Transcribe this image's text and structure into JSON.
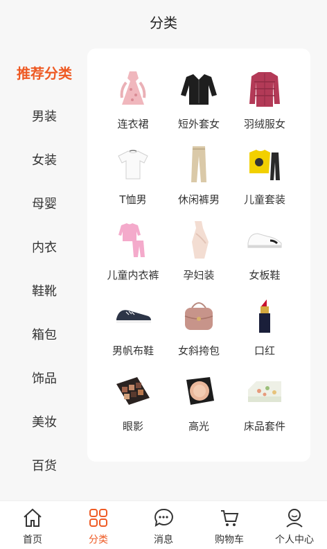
{
  "header": {
    "title": "分类"
  },
  "sidebar": {
    "items": [
      {
        "label": "推荐分类",
        "active": true
      },
      {
        "label": "男装"
      },
      {
        "label": "女装"
      },
      {
        "label": "母婴"
      },
      {
        "label": "内衣"
      },
      {
        "label": "鞋靴"
      },
      {
        "label": "箱包"
      },
      {
        "label": "饰品"
      },
      {
        "label": "美妆"
      },
      {
        "label": "百货"
      }
    ]
  },
  "grid": {
    "items": [
      {
        "label": "连衣裙",
        "icon": "dress-icon"
      },
      {
        "label": "短外套女",
        "icon": "cardigan-icon"
      },
      {
        "label": "羽绒服女",
        "icon": "down-jacket-icon"
      },
      {
        "label": "T恤男",
        "icon": "tshirt-icon"
      },
      {
        "label": "休闲裤男",
        "icon": "trousers-icon"
      },
      {
        "label": "儿童套装",
        "icon": "kids-set-icon"
      },
      {
        "label": "儿童内衣裤",
        "icon": "kids-underwear-icon"
      },
      {
        "label": "孕妇装",
        "icon": "maternity-dress-icon"
      },
      {
        "label": "女板鞋",
        "icon": "sneaker-icon"
      },
      {
        "label": "男帆布鞋",
        "icon": "canvas-shoe-icon"
      },
      {
        "label": "女斜挎包",
        "icon": "crossbody-bag-icon"
      },
      {
        "label": "口红",
        "icon": "lipstick-icon"
      },
      {
        "label": "眼影",
        "icon": "eyeshadow-icon"
      },
      {
        "label": "高光",
        "icon": "highlighter-icon"
      },
      {
        "label": "床品套件",
        "icon": "bedding-icon"
      }
    ]
  },
  "tabbar": {
    "items": [
      {
        "label": "首页",
        "icon": "home-icon"
      },
      {
        "label": "分类",
        "icon": "category-icon",
        "active": true
      },
      {
        "label": "消息",
        "icon": "message-icon"
      },
      {
        "label": "购物车",
        "icon": "cart-icon"
      },
      {
        "label": "个人中心",
        "icon": "profile-icon"
      }
    ]
  },
  "colors": {
    "accent": "#ee5a24",
    "background": "#f7f7f7",
    "panel": "#ffffff"
  }
}
